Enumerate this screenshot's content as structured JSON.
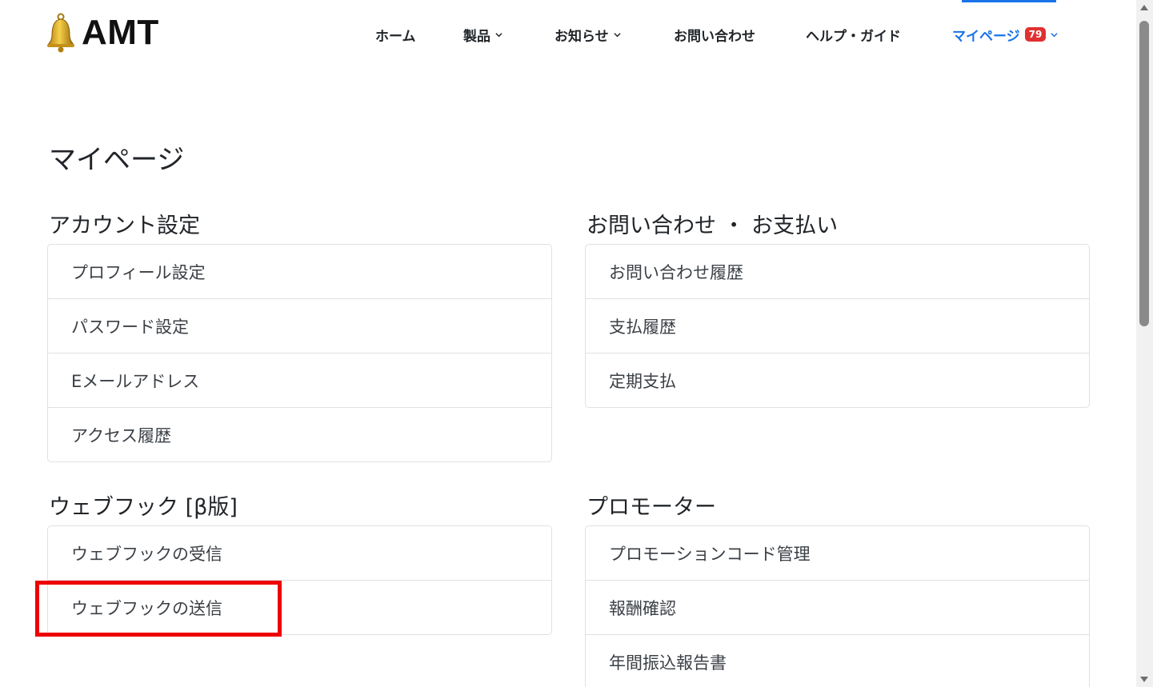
{
  "brand": {
    "name": "AMT"
  },
  "nav": {
    "items": [
      {
        "label": "ホーム",
        "has_dropdown": false
      },
      {
        "label": "製品",
        "has_dropdown": true
      },
      {
        "label": "お知らせ",
        "has_dropdown": true
      },
      {
        "label": "お問い合わせ",
        "has_dropdown": false
      },
      {
        "label": "ヘルプ・ガイド",
        "has_dropdown": false
      },
      {
        "label": "マイページ",
        "has_dropdown": true,
        "active": true,
        "badge": "79"
      }
    ],
    "active_color": "#1a73e8",
    "badge_color": "#e03131"
  },
  "page": {
    "title": "マイページ"
  },
  "sections": {
    "account": {
      "heading": "アカウント設定",
      "items": [
        "プロフィール設定",
        "パスワード設定",
        "Eメールアドレス",
        "アクセス履歴"
      ]
    },
    "support": {
      "heading": "お問い合わせ ・ お支払い",
      "items": [
        "お問い合わせ履歴",
        "支払履歴",
        "定期支払"
      ]
    },
    "webhook": {
      "heading": "ウェブフック [β版]",
      "items": [
        "ウェブフックの受信",
        "ウェブフックの送信"
      ]
    },
    "promoter": {
      "heading": "プロモーター",
      "items": [
        "プロモーションコード管理",
        "報酬確認",
        "年間振込報告書"
      ]
    }
  },
  "annotation": {
    "highlight_color": "#ee0000",
    "highlighted_item": "ウェブフックの送信"
  }
}
